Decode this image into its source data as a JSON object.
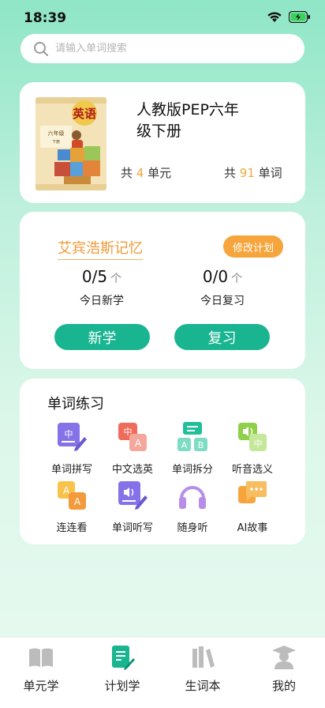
{
  "status": {
    "time": "18:39"
  },
  "search": {
    "placeholder": "请输入单词搜索"
  },
  "book": {
    "title": "人教版PEP六年级下册",
    "cover_title": "英语",
    "cover_grade": "六年级",
    "cover_volume": "下册",
    "units_prefix": "共",
    "units_count": "4",
    "units_suffix": "单元",
    "words_prefix": "共",
    "words_count": "91",
    "words_suffix": "单词"
  },
  "plan": {
    "name": "艾宾浩斯记忆",
    "edit_label": "修改计划",
    "new": {
      "value": "0/5",
      "unit": "个",
      "label": "今日新学"
    },
    "review": {
      "value": "0/0",
      "unit": "个",
      "label": "今日复习"
    },
    "learn_button": "新学",
    "review_button": "复习"
  },
  "practice": {
    "title": "单词练习",
    "items": [
      {
        "label": "单词拼写",
        "icon": "spelling-icon"
      },
      {
        "label": "中文选英",
        "icon": "chinese-to-english-icon"
      },
      {
        "label": "单词拆分",
        "icon": "word-split-icon"
      },
      {
        "label": "听音选义",
        "icon": "listen-choose-icon"
      },
      {
        "label": "连连看",
        "icon": "match-icon"
      },
      {
        "label": "单词听写",
        "icon": "dictation-icon"
      },
      {
        "label": "随身听",
        "icon": "headphones-icon"
      },
      {
        "label": "AI故事",
        "icon": "ai-story-icon"
      }
    ],
    "glyphs": {
      "zh": "中",
      "a": "A",
      "b": "B"
    }
  },
  "tabs": [
    {
      "label": "单元学",
      "icon": "book-open-icon"
    },
    {
      "label": "计划学",
      "icon": "plan-document-icon"
    },
    {
      "label": "生词本",
      "icon": "bookshelf-icon"
    },
    {
      "label": "我的",
      "icon": "profile-graduate-icon"
    }
  ],
  "colors": {
    "accent": "#19b591",
    "orange": "#f5a53c",
    "highlight_number": "#f2a83b"
  }
}
